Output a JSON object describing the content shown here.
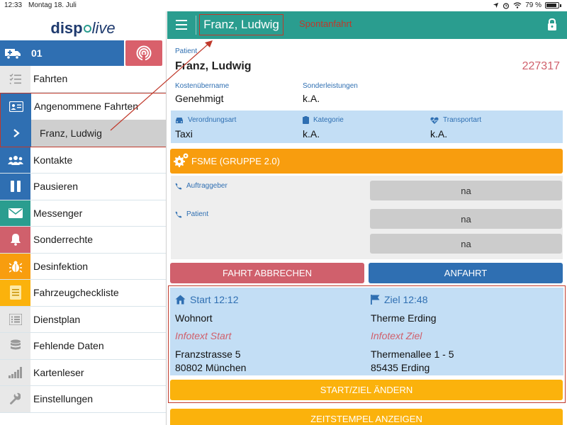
{
  "status_bar": {
    "time": "12:33",
    "date": "Montag 18. Juli",
    "battery": "79 %"
  },
  "logo": {
    "prefix": "disp",
    "suffix": "live"
  },
  "vehicle": {
    "number": "01",
    "icon": "ambulance-icon"
  },
  "menu": [
    {
      "label": "Fahrten",
      "icon": "list-icon",
      "color": "#e8e8e8"
    },
    {
      "label": "Angenommene Fahrten",
      "icon": "id-card-icon",
      "color": "#2f6fb2"
    },
    {
      "label": "Kontakte",
      "icon": "users-icon",
      "color": "#2f6fb2"
    },
    {
      "label": "Pausieren",
      "icon": "pause-icon",
      "color": "#2f6fb2"
    },
    {
      "label": "Messenger",
      "icon": "envelope-icon",
      "color": "#2a9d8f"
    },
    {
      "label": "Sonderrechte",
      "icon": "bell-icon",
      "color": "#d0606c"
    },
    {
      "label": "Desinfektion",
      "icon": "bug-icon",
      "color": "#f89d0e"
    },
    {
      "label": "Fahrzeugcheckliste",
      "icon": "checklist-icon",
      "color": "#fbb20c"
    },
    {
      "label": "Dienstplan",
      "icon": "list-icon",
      "color": "#e8e8e8"
    },
    {
      "label": "Fehlende Daten",
      "icon": "database-icon",
      "color": "#e8e8e8"
    },
    {
      "label": "Kartenleser",
      "icon": "signal-icon",
      "color": "#e8e8e8"
    },
    {
      "label": "Einstellungen",
      "icon": "wrench-icon",
      "color": "#e8e8e8"
    }
  ],
  "sub_item": {
    "label": "Franz, Ludwig",
    "icon": "chevron-right-icon"
  },
  "header": {
    "title": "Franz, Ludwig",
    "annotation": "Spontanfahrt"
  },
  "patient": {
    "label": "Patient",
    "name": "Franz, Ludwig",
    "id": "227317",
    "kosten_label": "Kostenübername",
    "kosten_value": "Genehmigt",
    "sonder_label": "Sonderleistungen",
    "sonder_value": "k.A."
  },
  "info_strip": {
    "verordnung_label": "Verordnungsart",
    "verordnung_value": "Taxi",
    "kategorie_label": "Kategorie",
    "kategorie_value": "k.A.",
    "transport_label": "Transportart",
    "transport_value": "k.A."
  },
  "group_bar": {
    "label": "FSME (GRUPPE 2.0)"
  },
  "contacts": {
    "auftraggeber_label": "Auftraggeber",
    "patient_label": "Patient",
    "na1": "na",
    "na2": "na",
    "na3": "na"
  },
  "actions": {
    "abbrechen": "FAHRT ABBRECHEN",
    "anfahrt": "ANFAHRT"
  },
  "route": {
    "start_head": "Start 12:12",
    "ziel_head": "Ziel 12:48",
    "start_place": "Wohnort",
    "ziel_place": "Therme Erding",
    "start_info": "Infotext Start",
    "ziel_info": "Infotext Ziel",
    "start_street": "Franzstrasse 5",
    "start_city": "80802 München",
    "ziel_street": "Thermenallee 1 - 5",
    "ziel_city": "85435 Erding"
  },
  "buttons": {
    "start_ziel": "START/ZIEL ÄNDERN",
    "zeitstempel": "ZEITSTEMPEL ANZEIGEN"
  }
}
